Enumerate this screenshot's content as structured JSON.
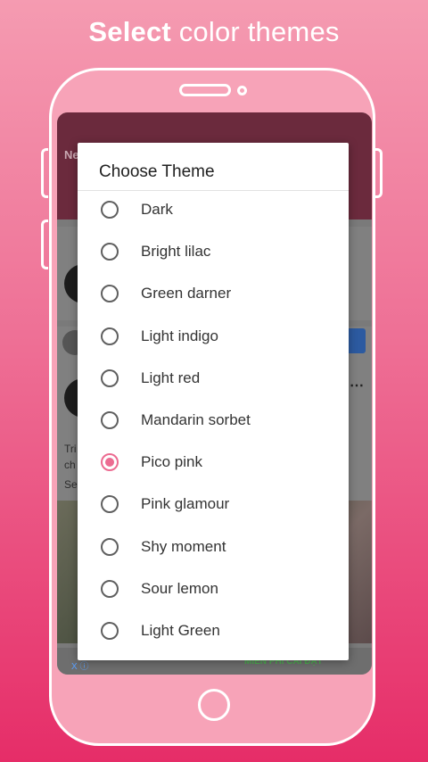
{
  "headline": {
    "bold": "Select",
    "rest": " color themes"
  },
  "background_app": {
    "app_bar_text": "Ne",
    "text_line1": "Tri",
    "text_line2": "ch",
    "text_line3": "Se",
    "ad_text": "MIỄN PHÍ CAI ĐẶT",
    "ad_mark": "X ⓘ"
  },
  "dialog": {
    "title": "Choose Theme",
    "selected_index": 6,
    "options": [
      {
        "label": "Dark"
      },
      {
        "label": "Bright lilac"
      },
      {
        "label": "Green darner"
      },
      {
        "label": "Light indigo"
      },
      {
        "label": "Light red"
      },
      {
        "label": "Mandarin sorbet"
      },
      {
        "label": "Pico pink"
      },
      {
        "label": "Pink glamour"
      },
      {
        "label": "Shy moment"
      },
      {
        "label": "Sour lemon"
      },
      {
        "label": "Light Green"
      }
    ]
  },
  "colors": {
    "accent": "#ec6b91",
    "background_top": "#f59bb1",
    "background_bottom": "#e62d68"
  }
}
